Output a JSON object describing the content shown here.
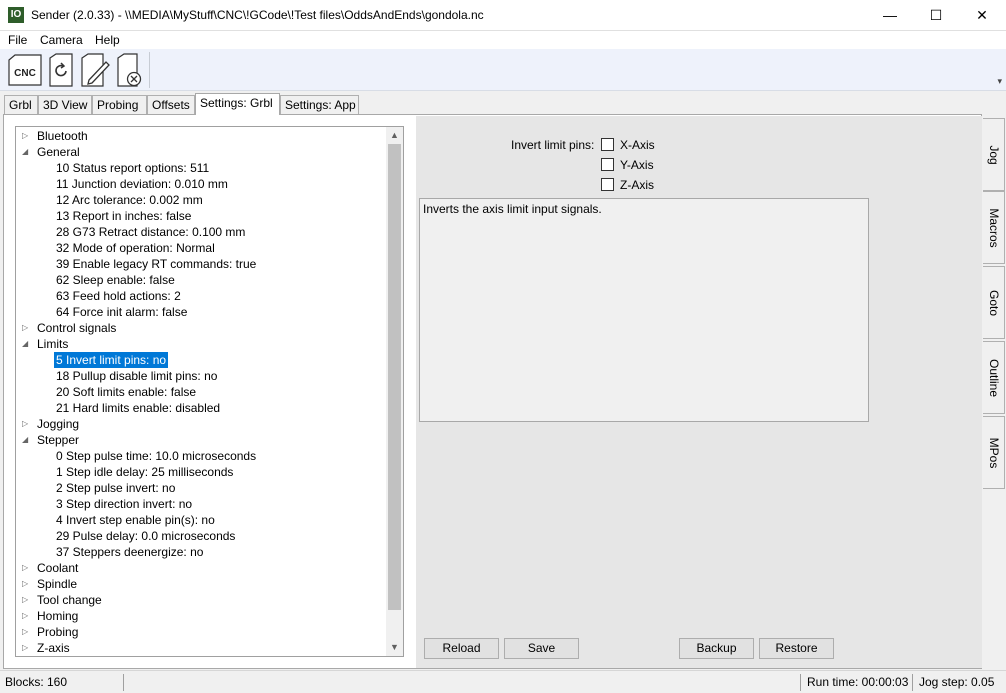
{
  "window": {
    "app_icon": "IO",
    "title": "Sender (2.0.33) - \\\\MEDIA\\MyStuff\\CNC\\!GCode\\!Test files\\OddsAndEnds\\gondola.nc",
    "minimize_glyph": "—",
    "maximize_glyph": "☐",
    "close_glyph": "✕"
  },
  "menu": [
    "File",
    "Camera",
    "Help"
  ],
  "toolbar": {
    "buttons": [
      "cnc-icon",
      "reload-icon",
      "edit-icon",
      "close-file-icon"
    ],
    "cnc_label": "CNC",
    "grip_glyph": "▾"
  },
  "tabs": [
    "Grbl",
    "3D View",
    "Probing",
    "Offsets",
    "Settings: Grbl",
    "Settings: App"
  ],
  "active_tab": "Settings: Grbl",
  "tree": [
    {
      "type": "group",
      "label": "Bluetooth",
      "expanded": false
    },
    {
      "type": "group",
      "label": "General",
      "expanded": true
    },
    {
      "type": "leaf",
      "label": "10 Status report options: 511"
    },
    {
      "type": "leaf",
      "label": "11 Junction deviation: 0.010 mm"
    },
    {
      "type": "leaf",
      "label": "12 Arc tolerance: 0.002 mm"
    },
    {
      "type": "leaf",
      "label": "13 Report in inches: false"
    },
    {
      "type": "leaf",
      "label": "28 G73 Retract distance: 0.100 mm"
    },
    {
      "type": "leaf",
      "label": "32 Mode of operation: Normal"
    },
    {
      "type": "leaf",
      "label": "39 Enable legacy RT commands: true"
    },
    {
      "type": "leaf",
      "label": "62 Sleep enable: false"
    },
    {
      "type": "leaf",
      "label": "63 Feed hold actions: 2"
    },
    {
      "type": "leaf",
      "label": "64 Force init alarm: false"
    },
    {
      "type": "group",
      "label": "Control signals",
      "expanded": false
    },
    {
      "type": "group",
      "label": "Limits",
      "expanded": true
    },
    {
      "type": "leaf",
      "label": "5 Invert limit pins: no",
      "selected": true
    },
    {
      "type": "leaf",
      "label": "18 Pullup disable limit pins: no"
    },
    {
      "type": "leaf",
      "label": "20 Soft limits enable: false"
    },
    {
      "type": "leaf",
      "label": "21 Hard limits enable: disabled"
    },
    {
      "type": "group",
      "label": "Jogging",
      "expanded": false
    },
    {
      "type": "group",
      "label": "Stepper",
      "expanded": true
    },
    {
      "type": "leaf",
      "label": "0 Step pulse time: 10.0 microseconds"
    },
    {
      "type": "leaf",
      "label": "1 Step idle delay: 25 milliseconds"
    },
    {
      "type": "leaf",
      "label": "2 Step pulse invert: no"
    },
    {
      "type": "leaf",
      "label": "3 Step direction invert: no"
    },
    {
      "type": "leaf",
      "label": "4 Invert step enable pin(s): no"
    },
    {
      "type": "leaf",
      "label": "29 Pulse delay: 0.0 microseconds"
    },
    {
      "type": "leaf",
      "label": "37 Steppers deenergize: no"
    },
    {
      "type": "group",
      "label": "Coolant",
      "expanded": false
    },
    {
      "type": "group",
      "label": "Spindle",
      "expanded": false
    },
    {
      "type": "group",
      "label": "Tool change",
      "expanded": false
    },
    {
      "type": "group",
      "label": "Homing",
      "expanded": false
    },
    {
      "type": "group",
      "label": "Probing",
      "expanded": false
    },
    {
      "type": "group",
      "label": "Z-axis",
      "expanded": false
    }
  ],
  "scrollbar": {
    "up_glyph": "▲",
    "down_glyph": "▼"
  },
  "detail": {
    "option_label": "Invert limit pins:",
    "checkboxes": [
      {
        "label": "X-Axis",
        "checked": false
      },
      {
        "label": "Y-Axis",
        "checked": false
      },
      {
        "label": "Z-Axis",
        "checked": false
      }
    ],
    "description": "Inverts the axis limit input signals.",
    "buttons": {
      "reload": "Reload",
      "save": "Save",
      "backup": "Backup",
      "restore": "Restore"
    }
  },
  "side_tabs": [
    "Jog",
    "Macros",
    "Goto",
    "Outline",
    "MPos"
  ],
  "status": {
    "blocks": "Blocks: 160",
    "run_time": "Run time: 00:00:03",
    "jog_step": "Jog step: 0.05"
  }
}
